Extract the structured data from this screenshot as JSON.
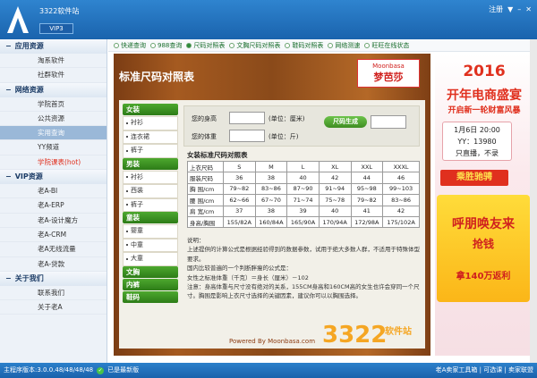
{
  "title_bar": {
    "app_name": "3322软件站",
    "badge": "VIP3",
    "login": "注册",
    "menu_icon": "menu-icon",
    "minimize_icon": "minimize-icon",
    "close_icon": "close-icon"
  },
  "sidebar": {
    "groups": [
      {
        "label": "应用资源",
        "items": [
          "淘系软件",
          "社群软件"
        ]
      },
      {
        "label": "网络资源",
        "items": [
          "学院首页",
          "公共资源",
          "实用查询",
          "YY频道",
          "学院课表(hot)"
        ]
      },
      {
        "label": "VIP资源",
        "items": [
          "老A-BI",
          "老A-ERP",
          "老A-设计魔方",
          "老A-CRM",
          "老A无线流量",
          "老A-贷款"
        ]
      },
      {
        "label": "关于我们",
        "items": [
          "联系我们",
          "关于老A"
        ]
      }
    ]
  },
  "tabs": [
    "快递查询",
    "988查询",
    "尺码对照表",
    "文胸尺码对照表",
    "鞋码对照表",
    "网络测速",
    "旺旺在线状态"
  ],
  "panel": {
    "title": "标准尺码对照表",
    "brand_en": "Moonbasa",
    "brand_cn": "梦芭莎",
    "categories": [
      {
        "label": "女装",
        "items": [
          "衬衫",
          "连衣裙",
          "裤子"
        ]
      },
      {
        "label": "男装",
        "items": [
          "衬衫",
          "西装",
          "裤子"
        ]
      },
      {
        "label": "童装",
        "items": [
          "婴童",
          "中童",
          "大童"
        ]
      },
      {
        "label": "文胸",
        "items": []
      },
      {
        "label": "内裤",
        "items": []
      },
      {
        "label": "鞋码",
        "items": []
      }
    ],
    "form": {
      "height_label": "您的身高",
      "height_unit": "(单位：厘米)",
      "weight_label": "您的体重",
      "weight_unit": "(单位：斤)",
      "button": "尺码生成"
    },
    "table_title": "女装标准尺码对照表",
    "table": [
      [
        "上衣尺码",
        "S",
        "M",
        "L",
        "XL",
        "XXL",
        "XXXL"
      ],
      [
        "服装尺码",
        "36",
        "38",
        "40",
        "42",
        "44",
        "46"
      ],
      [
        "胸 围/cm",
        "79~82",
        "83~86",
        "87~90",
        "91~94",
        "95~98",
        "99~103"
      ],
      [
        "腰 围/cm",
        "62~66",
        "67~70",
        "71~74",
        "75~78",
        "79~82",
        "83~86"
      ],
      [
        "肩 宽/cm",
        "37",
        "38",
        "39",
        "40",
        "41",
        "42"
      ],
      [
        "身高/胸围",
        "155/82A",
        "160/84A",
        "165/90A",
        "170/94A",
        "172/98A",
        "175/102A"
      ]
    ],
    "notes": [
      "说明：",
      "上述提供的计算公式是根据经验得到的数据参数，试用于绝大多数人群，不适用于特殊体型要求。",
      "国内比较普遍的一个判断胖瘦的公式是：",
      "女性之标准体重（千克）＝身长（厘米）－102",
      "注意：身高体重与尺寸没有绝对的关系，155CM身高和160CM高的女生也许会穿同一个尺寸。胸围是影响上衣尺寸选择的关键因素，建议你可以以胸围选择。"
    ],
    "powered": "Powered By Moonbasa.com"
  },
  "ad": {
    "year": "2016",
    "headline": "开年电商盛宴",
    "sub": "开启新一轮财富风暴",
    "card_lines": [
      "1月6日 20:00",
      "YY：13980",
      "只直播，不录"
    ],
    "button": "乘胜驰骋",
    "banner_1": "呼朋唤友来",
    "banner_2": "抢钱",
    "banner_3": "拿140万返利"
  },
  "watermark": {
    "num": "3322",
    "txt": "软件站"
  },
  "status_bar": {
    "version": "主程序版本:3.0.0.48/48/48/48",
    "update": "已是最新版",
    "right": "老A卖家工具箱 | 可选课 | 卖家联盟"
  }
}
